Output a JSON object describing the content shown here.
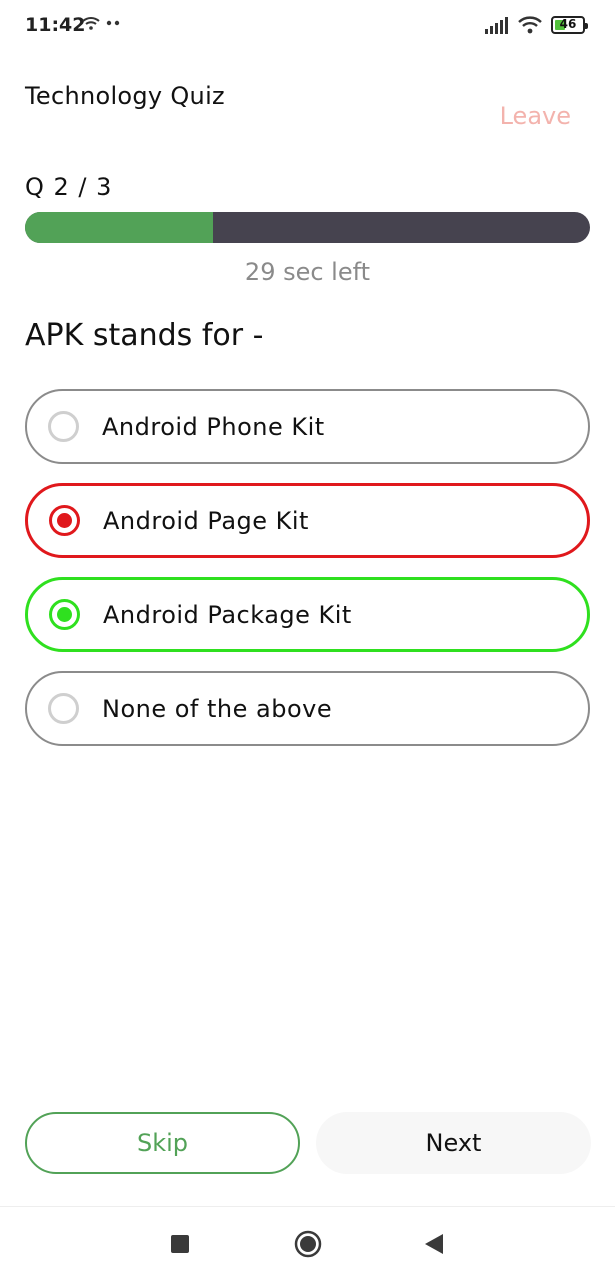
{
  "status_bar": {
    "time": "11:42",
    "battery_level": "46",
    "battery_fraction": 0.46,
    "icons": [
      "wifi-icon",
      "dots-icon",
      "signal-icon",
      "wifi-icon",
      "battery-icon"
    ]
  },
  "header": {
    "title": "Technology Quiz",
    "leave_label": "Leave"
  },
  "progress": {
    "counter": "Q 2 / 3",
    "fraction": 0.333,
    "timer": "29 sec left"
  },
  "question": {
    "text": "APK stands for -",
    "options": [
      {
        "label": "Android Phone Kit",
        "state": "unselected"
      },
      {
        "label": "Android Page Kit",
        "state": "wrong"
      },
      {
        "label": "Android Package Kit",
        "state": "correct"
      },
      {
        "label": "None of the above",
        "state": "unselected"
      }
    ]
  },
  "actions": {
    "skip_label": "Skip",
    "next_label": "Next"
  },
  "colors": {
    "accent_green": "#52a257",
    "correct": "#2fe01f",
    "wrong": "#e0181c",
    "leave": "#f3b3ad",
    "progress_track": "#46434f"
  },
  "nav_bar": {
    "icons": [
      "recents-square-icon",
      "home-circle-icon",
      "back-triangle-icon"
    ]
  }
}
